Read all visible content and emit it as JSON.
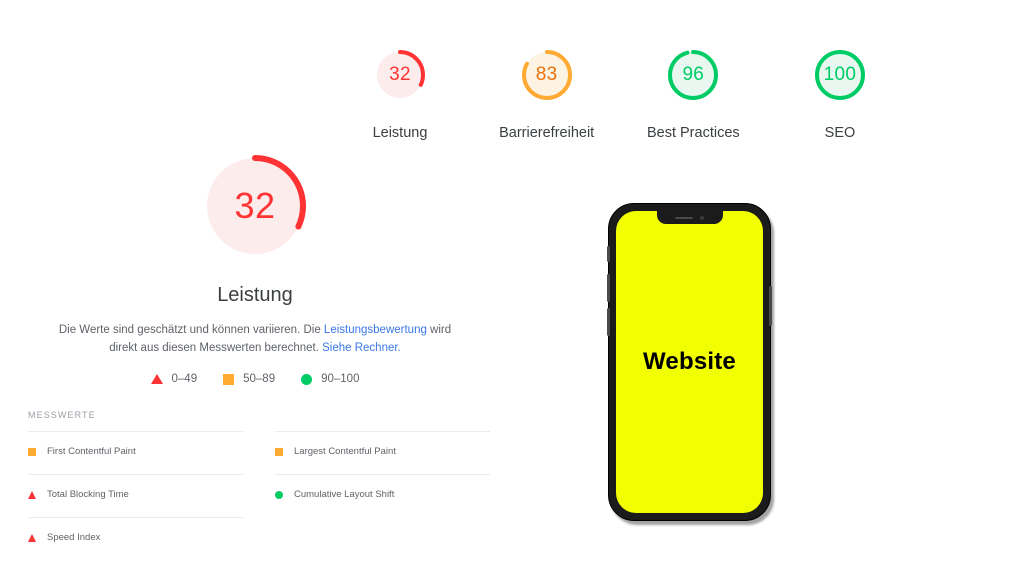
{
  "summary": {
    "items": [
      {
        "score": "32",
        "label": "Leistung",
        "color": "#f33",
        "track": "#fdecec",
        "percent": 32
      },
      {
        "score": "83",
        "label": "Barrierefreiheit",
        "color": "#fa3",
        "track": "#fdf3e3",
        "percent": 83
      },
      {
        "score": "96",
        "label": "Best Practices",
        "color": "#0c6",
        "track": "#e8f8f0",
        "percent": 96
      },
      {
        "score": "100",
        "label": "SEO",
        "color": "#0c6",
        "track": "#e8f8f0",
        "percent": 100
      }
    ]
  },
  "big_gauge": {
    "score": "32",
    "percent": 32,
    "title": "Leistung",
    "color": "#f33",
    "track": "#fdecec",
    "description": {
      "part1": "Die Werte sind geschätzt und können variieren. Die ",
      "link1": "Leistungsbewertung",
      "part2": " wird direkt aus diesen Messwerten berechnet. ",
      "link2": "Siehe Rechner."
    }
  },
  "legend": {
    "items": [
      {
        "shape": "triangle",
        "label": "0–49",
        "color": "#f33"
      },
      {
        "shape": "square",
        "label": "50–89",
        "color": "#fa3"
      },
      {
        "shape": "circle",
        "label": "90–100",
        "color": "#0c6"
      }
    ]
  },
  "metrics": {
    "heading": "MESSWERTE",
    "items": [
      {
        "label": "First Contentful Paint",
        "shape": "square",
        "color": "#fa3"
      },
      {
        "label": "Largest Contentful Paint",
        "shape": "square",
        "color": "#fa3"
      },
      {
        "label": "Total Blocking Time",
        "shape": "triangle",
        "color": "#f33"
      },
      {
        "label": "Cumulative Layout Shift",
        "shape": "circle",
        "color": "#0c6"
      },
      {
        "label": "Speed Index",
        "shape": "triangle",
        "color": "#f33"
      }
    ]
  },
  "phone": {
    "screen_text": "Website",
    "screen_color": "#f2ff00",
    "frame_color": "#1b1b1b"
  }
}
